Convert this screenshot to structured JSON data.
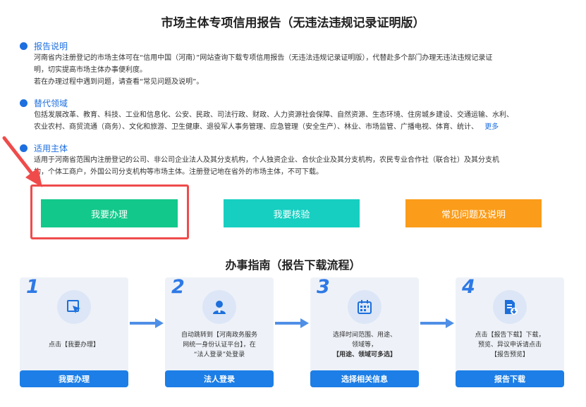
{
  "header": {
    "title": "市场主体专项信用报告（无违法违规记录证明版）"
  },
  "sections": [
    {
      "title": "报告说明",
      "lines": [
        "河南省内注册登记的市场主体可在“信用中国（河南）”网站查询下载专项信用报告（无违法违规记录证明版），代替赴多个部门办理无违法违规记录证",
        "明，切实提高市场主体办事便利度。",
        "若在办理过程中遇到问题，请查看“常见问题及说明”。"
      ]
    },
    {
      "title": "替代领域",
      "lines": [
        "包括发展改革、教育、科技、工业和信息化、公安、民政、司法行政、财政、人力资源社会保障、自然资源、生态环境、住房城乡建设、交通运输、水利、",
        "农业农村、商贸流通（商务）、文化和旅游、卫生健康、退役军人事务管理、应急管理（安全生产）、林业、市场监管、广播电视、体育、统计、"
      ],
      "more": "更多"
    },
    {
      "title": "适用主体",
      "lines": [
        "适用于河南省范围内注册登记的公司、非公司企业法人及其分支机构，个人独资企业、合伙企业及其分支机构，农民专业合作社（联合社）及其分支机",
        "构，个体工商户，外国公司分支机构等市场主体。注册登记地在省外的市场主体，不可下载。"
      ]
    }
  ],
  "actions": {
    "apply": "我要办理",
    "verify": "我要核验",
    "faq": "常见问题及说明"
  },
  "guide": {
    "title": "办事指南（报告下载流程）",
    "steps": [
      {
        "num": "1",
        "icon": "click-cursor-icon",
        "lines": [
          "点击【我要办理】"
        ],
        "button": "我要办理"
      },
      {
        "num": "2",
        "icon": "user-icon",
        "lines": [
          "自动跳转到【河南政务服务",
          "网统一身份认证平台】，在",
          "“法人登录”处登录"
        ],
        "button": "法人登录"
      },
      {
        "num": "3",
        "icon": "calendar-icon",
        "lines": [
          "选择时间范围、用途、",
          "领域等，",
          "【用途、领域可多选】"
        ],
        "button": "选择相关信息"
      },
      {
        "num": "4",
        "icon": "document-download-icon",
        "lines": [
          "点击【报告下载】下载，",
          "预览、异议申诉请点击",
          "【报告预览】"
        ],
        "button": "报告下载"
      }
    ]
  },
  "colors": {
    "accent": "#1d6fe0",
    "apply": "#12c88a",
    "verify": "#16cfc1",
    "faq": "#fb9c1a",
    "highlight": "#ef4b4b",
    "step_button": "#1c7ee6"
  }
}
